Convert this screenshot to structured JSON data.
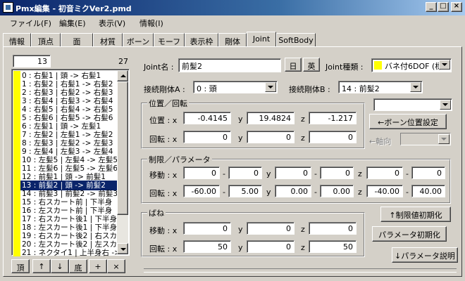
{
  "window": {
    "title": "Pmx編集 - 初音ミクVer2.pmd"
  },
  "menu": [
    "ファイル(F)",
    "編集(E)",
    "表示(V)",
    "情報(I)"
  ],
  "tabs": [
    "情報",
    "頂点",
    "面",
    "材質",
    "ボーン",
    "モーフ",
    "表示枠",
    "剛体",
    "Joint",
    "SoftBody"
  ],
  "active_tab": "Joint",
  "list": {
    "current_index": "13",
    "count": "27",
    "items": [
      "0 : 右髪1 | 頭 -> 右髪1",
      "1 : 右髪2 | 右髪1 -> 右髪2",
      "2 : 右髪3 | 右髪2 -> 右髪3",
      "3 : 右髪4 | 右髪3 -> 右髪4",
      "4 : 右髪5 | 右髪4 -> 右髪5",
      "5 : 右髪6 | 右髪5 -> 右髪6",
      "6 : 左髪1 | 頭 -> 左髪1",
      "7 : 左髪2 | 左髪1 -> 左髪2",
      "8 : 左髪3 | 左髪2 -> 左髪3",
      "9 : 左髪4 | 左髪3 -> 左髪4",
      "10 : 左髪5 | 左髪4 -> 左髪5",
      "11 : 左髪6 | 左髪5 -> 左髪6",
      "12 : 前髪1 | 頭 -> 前髪1",
      "13 : 前髪2 | 頭 -> 前髪2",
      "14 : 前髪3 | 前髪2 -> 前髪3",
      "15 : 右スカート前 | 下半身",
      "16 : 左スカート前 | 下半身",
      "17 : 右スカート後1 | 下半身",
      "18 : 左スカート後1 | 下半身",
      "19 : 右スカート後2 | 右スカ",
      "20 : 左スカート後2 | 左スカ",
      "21 : ネクタイ1 | 上半身右 ->"
    ],
    "buttons": [
      "頂",
      "↑",
      "↓",
      "底",
      "+",
      "×"
    ]
  },
  "joint": {
    "name_label": "Joint名 :",
    "name_value": "前髪2",
    "btn_jp": "日",
    "btn_en": "英",
    "type_label": "Joint種類 :",
    "type_value": "バネ付6DOF (標",
    "body_a_label": "接続剛体A :",
    "body_a_value": "0 : 頭",
    "body_b_label": "接続剛体B :",
    "body_b_value": "14 : 前髪2",
    "extra_combo": "",
    "pos_group": "位置／回転",
    "pos_label": "位置 : x",
    "rot_label": "回転 : x",
    "pos": {
      "x": "-0.4145",
      "y": "19.4824",
      "z": "-1.217"
    },
    "rot": {
      "x": "0",
      "y": "0",
      "z": "0"
    },
    "bone_pos_button": "←ボーン位置設定",
    "axis_label": "←軸向",
    "axis_value": "",
    "limit_group": "制限／パラメータ",
    "move_label": "移動 : x",
    "rot2_label": "回転 : x",
    "move_limit": {
      "x_min": "0",
      "x_max": "0",
      "y_min": "0",
      "y_max": "0",
      "z_min": "0",
      "z_max": "0"
    },
    "rot_limit": {
      "x_min": "-60.00",
      "x_max": "5.00",
      "y_min": "0.00",
      "y_max": "0.00",
      "z_min": "-40.00",
      "z_max": "40.00"
    },
    "spring_group": "ばね",
    "spring_move_label": "移動 : x",
    "spring_rot_label": "回転 : x",
    "spring_move": {
      "x": "0",
      "y": "0",
      "z": "0"
    },
    "spring_rot": {
      "x": "50",
      "y": "0",
      "z": "50"
    },
    "reset_limit_button": "↑制限値初期化",
    "reset_param_button": "パラメータ初期化",
    "param_help_button": "↓パラメータ説明",
    "y": "y",
    "z": "z",
    "dash": "-"
  },
  "colors": {
    "title_start": "#0a246a",
    "title_end": "#a6caf0",
    "marker": "#ffff00",
    "selection": "#0a246a"
  }
}
